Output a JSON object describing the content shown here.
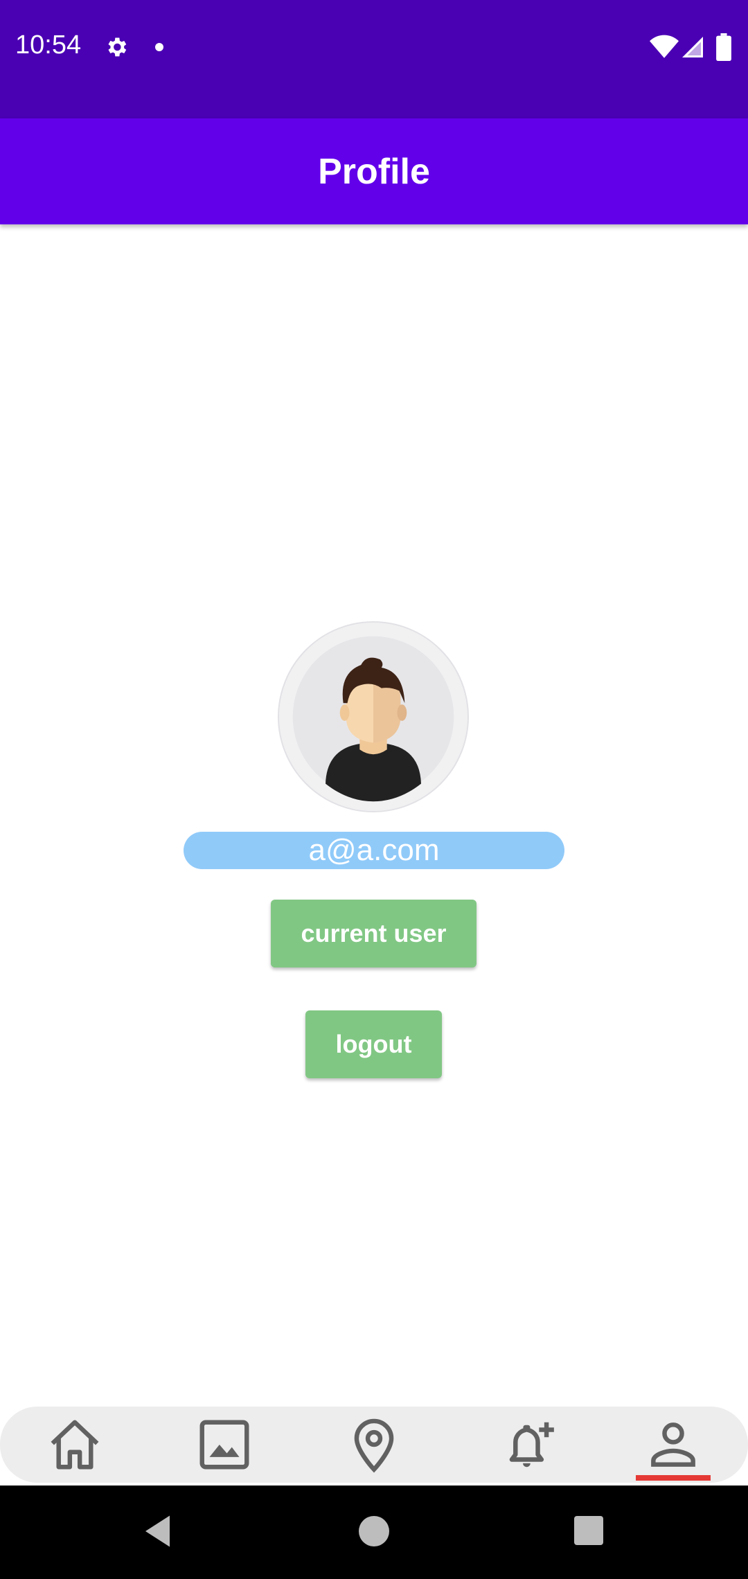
{
  "status_bar": {
    "time": "10:54"
  },
  "app_bar": {
    "title": "Profile"
  },
  "profile": {
    "email": "a@a.com",
    "current_user_label": "current user",
    "logout_label": "logout"
  },
  "bottom_nav": {
    "items": [
      "home-icon",
      "gallery-icon",
      "location-pin-icon",
      "add-alert-icon",
      "profile-icon"
    ],
    "selected": "profile-icon"
  },
  "colors": {
    "status_bar": "#4a00b3",
    "app_bar": "#6200ea",
    "email_pill": "#90caf9",
    "button": "#81c784",
    "nav_indicator": "#e53935"
  }
}
